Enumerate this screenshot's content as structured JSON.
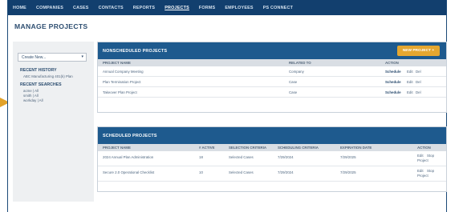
{
  "nav": {
    "items": [
      "HOME",
      "COMPANIES",
      "CASES",
      "CONTACTS",
      "REPORTS",
      "PROJECTS",
      "FORMS",
      "EMPLOYEES",
      "PS CONNECT"
    ],
    "active_index": 5
  },
  "page_title": "MANAGE PROJECTS",
  "sidebar": {
    "create_select": {
      "value": "Create New..."
    },
    "recent_history": {
      "heading": "RECENT HISTORY",
      "items": [
        "ABC Manufacturing 401(k) Plan"
      ]
    },
    "recent_searches": {
      "heading": "RECENT SEARCHES",
      "items": [
        "acme | All",
        "smith | All",
        "workday | All"
      ]
    }
  },
  "nonscheduled": {
    "title": "NONSCHEDULED PROJECTS",
    "new_button": "NEW PROJECT +",
    "columns": [
      "PROJECT NAME",
      "RELATED TO",
      "ACTION"
    ],
    "rows": [
      {
        "name": "Annual Company Meeting",
        "related": "Company",
        "schedule": "Schedule",
        "edit": "Edit",
        "del": "Del"
      },
      {
        "name": "Plan Termination Project",
        "related": "Case",
        "schedule": "Schedule",
        "edit": "Edit",
        "del": "Del"
      },
      {
        "name": "Takeover Plan Project",
        "related": "Case",
        "schedule": "Schedule",
        "edit": "Edit",
        "del": "Del"
      }
    ]
  },
  "scheduled": {
    "title": "SCHEDULED PROJECTS",
    "columns": [
      "PROJECT NAME",
      "# ACTIVE",
      "SELECTION CRITERIA",
      "SCHEDULING CRITERIA",
      "EXPIRATION DATE",
      "ACTION"
    ],
    "rows": [
      {
        "name": "2024 Annual Plan Administration",
        "active": "18",
        "selection": "Selected Cases",
        "scheduling": "7/29/2024",
        "expiration": "7/29/2025",
        "actions": [
          "Edit",
          "Stop",
          "Project"
        ]
      },
      {
        "name": "Secure 2.0 Operational Checklist",
        "active": "10",
        "selection": "Selected Cases",
        "scheduling": "7/29/2024",
        "expiration": "7/29/2025",
        "actions": [
          "Edit",
          "Stop",
          "Project"
        ]
      }
    ]
  },
  "colors": {
    "nav_bg": "#123f6e",
    "panel_head": "#1e5a8e",
    "accent": "#e5a730"
  }
}
